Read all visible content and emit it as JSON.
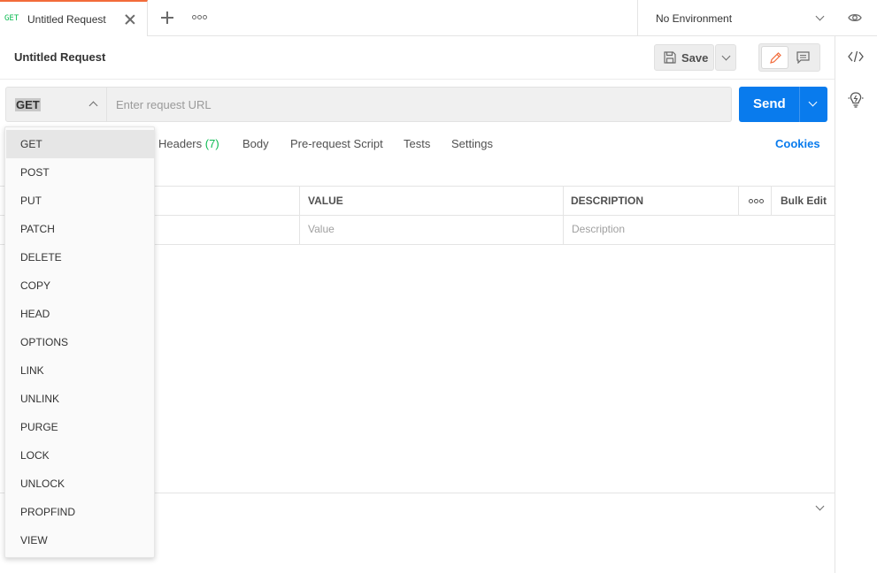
{
  "tab": {
    "method": "GET",
    "title": "Untitled Request"
  },
  "environment": {
    "label": "No Environment"
  },
  "request": {
    "title": "Untitled Request",
    "save_label": "Save"
  },
  "url_bar": {
    "method": "GET",
    "placeholder": "Enter request URL",
    "send_label": "Send"
  },
  "subtabs": {
    "headers": "Headers",
    "headers_count": "(7)",
    "body": "Body",
    "pre_request": "Pre-request Script",
    "tests": "Tests",
    "settings": "Settings",
    "cookies": "Cookies"
  },
  "params_table": {
    "headers": [
      "VALUE",
      "DESCRIPTION",
      "Bulk Edit"
    ],
    "placeholders": [
      "Value",
      "Description"
    ]
  },
  "method_menu": {
    "items": [
      "GET",
      "POST",
      "PUT",
      "PATCH",
      "DELETE",
      "COPY",
      "HEAD",
      "OPTIONS",
      "LINK",
      "UNLINK",
      "PURGE",
      "LOCK",
      "UNLOCK",
      "PROPFIND",
      "VIEW"
    ],
    "selected": "GET"
  },
  "colors": {
    "accent": "#097bed",
    "tab_indicator": "#f26b3a",
    "method_get": "#0cbb52"
  },
  "icons": [
    "close-icon",
    "plus-icon",
    "more-icon",
    "chevron-down-icon",
    "eye-icon",
    "code-icon",
    "bulb-icon",
    "save-icon",
    "pencil-icon",
    "comment-icon",
    "chevron-up-icon"
  ]
}
